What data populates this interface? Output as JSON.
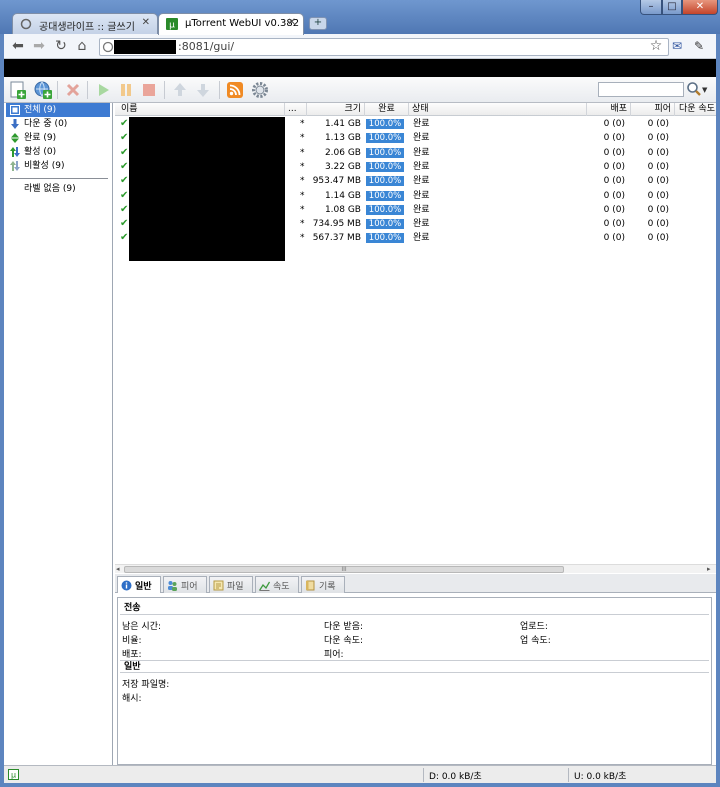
{
  "browser": {
    "tabs": [
      {
        "label": "공대생라이프 :: 글쓰기",
        "active": false
      },
      {
        "label": "µTorrent WebUI v0.382",
        "active": true
      }
    ],
    "new_tab_label": "+",
    "window_buttons": {
      "minimize": "–",
      "maximize": "□",
      "close": "✕"
    },
    "address_suffix": ":8081/gui/"
  },
  "toolbar": {
    "search_placeholder": ""
  },
  "sidebar": {
    "categories": [
      {
        "label": "전체 (9)",
        "icon": "all-icon",
        "selected": true
      },
      {
        "label": "다운 중 (0)",
        "icon": "down-arrow-icon"
      },
      {
        "label": "완료 (9)",
        "icon": "up-down-arrow-icon"
      },
      {
        "label": "활성 (0)",
        "icon": "active-icon"
      },
      {
        "label": "비활성 (9)",
        "icon": "inactive-icon"
      }
    ],
    "labels": [
      {
        "label": "라벨 없음 (9)"
      }
    ]
  },
  "list": {
    "columns": {
      "name": "이름",
      "more": "...",
      "size": "크기",
      "done": "완료",
      "status": "상태",
      "seeds": "배포",
      "peers": "피어",
      "down_speed": "다운 속도"
    },
    "rows": [
      {
        "star": "*",
        "size": "1.41 GB",
        "done": "100.0%",
        "status": "완료",
        "seeds": "0 (0)",
        "peers": "0 (0)"
      },
      {
        "star": "*",
        "size": "1.13 GB",
        "done": "100.0%",
        "status": "완료",
        "seeds": "0 (0)",
        "peers": "0 (0)"
      },
      {
        "star": "*",
        "size": "2.06 GB",
        "done": "100.0%",
        "status": "완료",
        "seeds": "0 (0)",
        "peers": "0 (0)"
      },
      {
        "star": "*",
        "size": "3.22 GB",
        "done": "100.0%",
        "status": "완료",
        "seeds": "0 (0)",
        "peers": "0 (0)"
      },
      {
        "star": "*",
        "size": "953.47 MB",
        "done": "100.0%",
        "status": "완료",
        "seeds": "0 (0)",
        "peers": "0 (0)"
      },
      {
        "star": "*",
        "size": "1.14 GB",
        "done": "100.0%",
        "status": "완료",
        "seeds": "0 (0)",
        "peers": "0 (0)"
      },
      {
        "star": "*",
        "size": "1.08 GB",
        "done": "100.0%",
        "status": "완료",
        "seeds": "0 (0)",
        "peers": "0 (0)"
      },
      {
        "star": "*",
        "size": "734.95 MB",
        "done": "100.0%",
        "status": "완료",
        "seeds": "0 (0)",
        "peers": "0 (0)"
      },
      {
        "star": "*",
        "size": "567.37 MB",
        "done": "100.0%",
        "status": "완료",
        "seeds": "0 (0)",
        "peers": "0 (0)"
      }
    ],
    "scroll_grip": "III",
    "scroll_left": "◂",
    "scroll_right": "▸"
  },
  "details": {
    "tabs": [
      {
        "label": "일반",
        "icon": "info-icon"
      },
      {
        "label": "피어",
        "icon": "peers-icon"
      },
      {
        "label": "파일",
        "icon": "files-icon"
      },
      {
        "label": "속도",
        "icon": "speed-chart-icon"
      },
      {
        "label": "기록",
        "icon": "log-icon"
      }
    ],
    "transfer_title": "전송",
    "transfer": {
      "remaining": "남은 시간:",
      "downloaded": "다운 받음:",
      "uploaded": "업로드:",
      "ratio": "비율:",
      "down_speed": "다운 속도:",
      "up_speed": "업 속도:",
      "seeds": "배포:",
      "peers": "피어:"
    },
    "general_title": "일반",
    "general": {
      "save_as": "저장 파일명:",
      "hash": "해시:"
    }
  },
  "statusbar": {
    "download": "D: 0.0 kB/초",
    "upload": "U: 0.0 kB/초"
  },
  "colors": {
    "progress": "#3a86d5",
    "selected": "#3e7bd2",
    "check": "#2d9b2d"
  }
}
